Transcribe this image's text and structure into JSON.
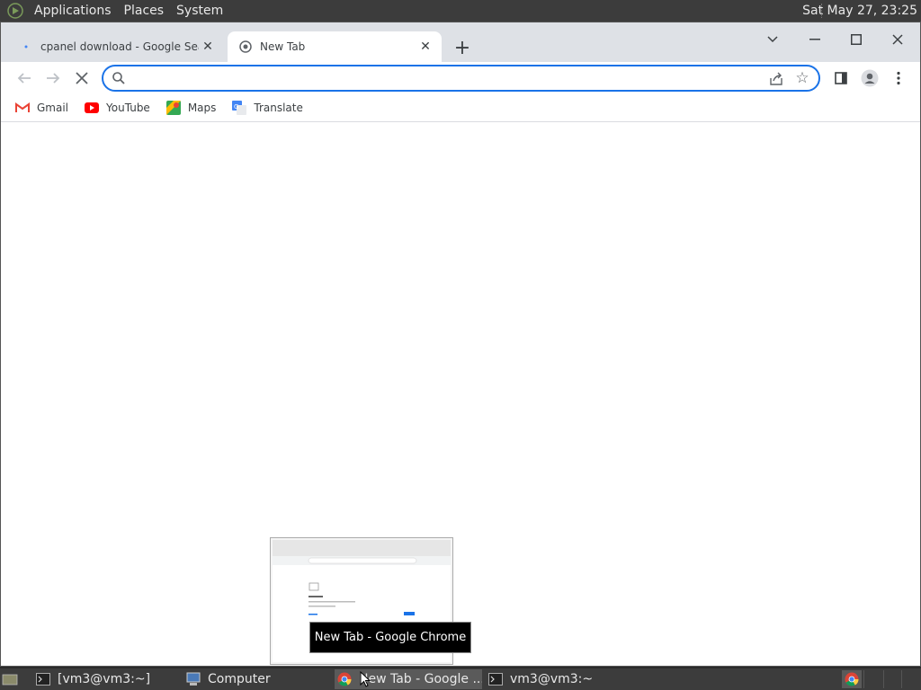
{
  "top_panel": {
    "menus": [
      "Applications",
      "Places",
      "System"
    ],
    "clock": "Sat May 27, 23:25"
  },
  "chrome": {
    "tabs": [
      {
        "title": "cpanel download - Google Search",
        "icon": "google-favicon",
        "active": false
      },
      {
        "title": "New Tab",
        "icon": "chrome-newtab-favicon",
        "active": true
      }
    ],
    "omnibox": {
      "value": "",
      "placeholder": ""
    },
    "bookmarks": [
      {
        "label": "Gmail",
        "icon": "gmail-icon"
      },
      {
        "label": "YouTube",
        "icon": "youtube-icon"
      },
      {
        "label": "Maps",
        "icon": "maps-icon"
      },
      {
        "label": "Translate",
        "icon": "translate-icon"
      }
    ]
  },
  "preview_tooltip": "New Tab - Google Chrome",
  "taskbar": {
    "tasks": [
      {
        "label": "[vm3@vm3:~]",
        "icon": "terminal-icon"
      },
      {
        "label": "Computer",
        "icon": "computer-icon"
      },
      {
        "label": "New Tab - Google ...",
        "icon": "chrome-icon"
      },
      {
        "label": "vm3@vm3:~",
        "icon": "terminal-icon"
      }
    ]
  },
  "colors": {
    "accent": "#1a73e8",
    "panel": "#3c3c3c",
    "tabstrip": "#dee1e6"
  }
}
